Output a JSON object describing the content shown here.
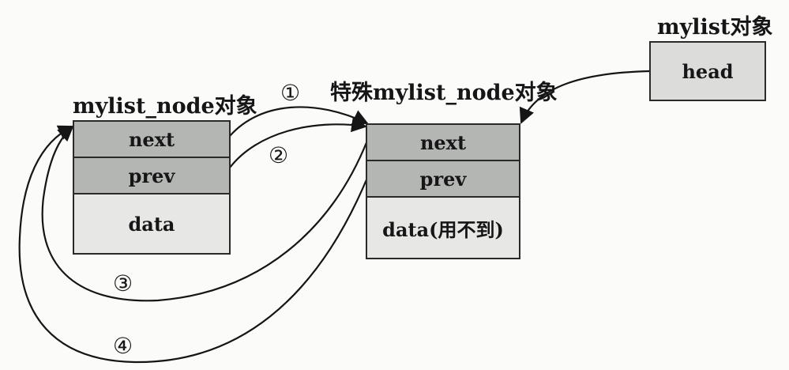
{
  "labels": {
    "left_object": "mylist_node对象",
    "middle_object": "特殊mylist_node对象",
    "right_object": "mylist对象"
  },
  "left_node": {
    "next": "next",
    "prev": "prev",
    "data": "data"
  },
  "middle_node": {
    "next": "next",
    "prev": "prev",
    "data": "data(用不到)"
  },
  "right_node": {
    "head": "head"
  },
  "markers": [
    "①",
    "②",
    "③",
    "④"
  ]
}
